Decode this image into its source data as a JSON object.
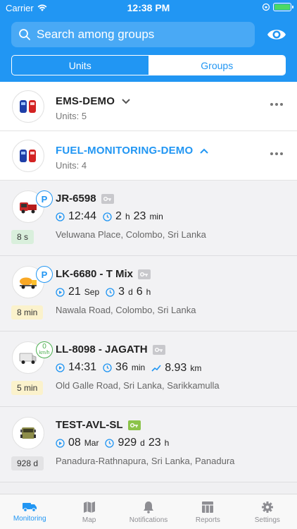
{
  "status_bar": {
    "carrier": "Carrier",
    "time": "12:38 PM",
    "battery_level": 1.0
  },
  "search": {
    "placeholder": "Search among groups"
  },
  "segments": {
    "units": "Units",
    "groups": "Groups",
    "selected": "Groups"
  },
  "groups": [
    {
      "name": "EMS-DEMO",
      "units": "Units: 5",
      "expanded": false,
      "color": "#222222"
    },
    {
      "name": "FUEL-MONITORING-DEMO",
      "units": "Units: 4",
      "expanded": true,
      "color": "#2196f3"
    }
  ],
  "units": [
    {
      "name": "JR-6598",
      "badge": "P",
      "time_ago": "8 s",
      "stat1": {
        "main": "12:44",
        "unit": ""
      },
      "stat2": {
        "a": "2",
        "a_unit": "h",
        "b": "23",
        "b_unit": "min"
      },
      "address": "Veluwana Place, Colombo, Sri Lanka"
    },
    {
      "name": "LK-6680 - T Mix",
      "badge": "P",
      "time_ago": "8 min",
      "stat1": {
        "main": "21",
        "unit": "Sep"
      },
      "stat2": {
        "a": "3",
        "a_unit": "d",
        "b": "6",
        "b_unit": "h"
      },
      "address": "Nawala Road, Colombo, Sri Lanka"
    },
    {
      "name": "LL-8098 - JAGATH",
      "badge_value": "0",
      "badge_unit": "km/h",
      "time_ago": "5 min",
      "stat1": {
        "main": "14:31",
        "unit": ""
      },
      "stat2": {
        "a": "36",
        "a_unit": "min",
        "b": "",
        "b_unit": ""
      },
      "stat3": {
        "value": "8.93",
        "unit": "km"
      },
      "address": "Old Galle Road, Sri Lanka, Sarikkamulla"
    },
    {
      "name": "TEST-AVL-SL",
      "time_ago": "928 d",
      "stat1": {
        "main": "08",
        "unit": "Mar"
      },
      "stat2": {
        "a": "929",
        "a_unit": "d",
        "b": "23",
        "b_unit": "h"
      },
      "address": "Panadura-Rathnapura, Sri Lanka, Panadura"
    }
  ],
  "tabs": [
    {
      "label": "Monitoring",
      "icon": "truck-icon",
      "active": true
    },
    {
      "label": "Map",
      "icon": "map-icon",
      "active": false
    },
    {
      "label": "Notifications",
      "icon": "bell-icon",
      "active": false
    },
    {
      "label": "Reports",
      "icon": "table-icon",
      "active": false
    },
    {
      "label": "Settings",
      "icon": "gear-icon",
      "active": false
    }
  ],
  "colors": {
    "primary": "#2196f3",
    "green": "#4caf50",
    "yellow_badge": "#fbf2cc",
    "green_badge": "#d9efdc"
  }
}
